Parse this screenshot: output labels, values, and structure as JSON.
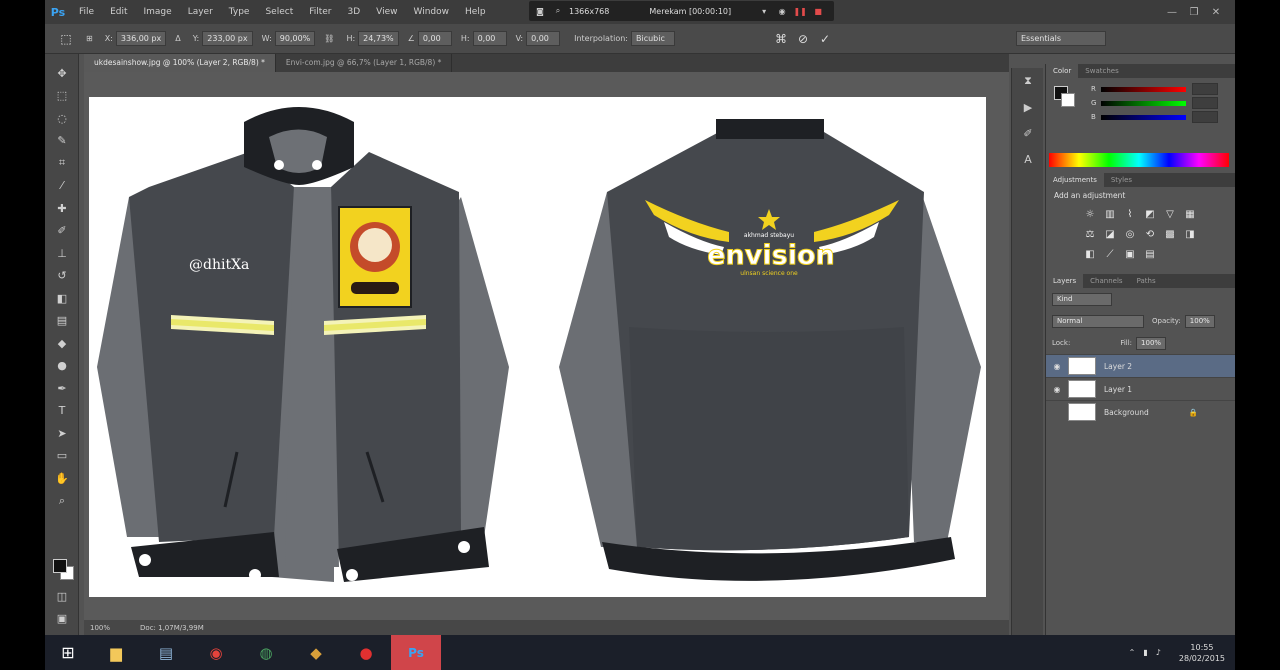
{
  "menubar": {
    "logo": "Ps",
    "items": [
      "File",
      "Edit",
      "Image",
      "Layer",
      "Type",
      "Select",
      "Filter",
      "3D",
      "View",
      "Window",
      "Help"
    ]
  },
  "recorder": {
    "resolution": "1366x768",
    "status": "Merekam [00:00:10]"
  },
  "options_bar": {
    "x": "336,00 px",
    "y": "233,00 px",
    "w": "90,00%",
    "h": "24,73%",
    "angle": "0,00",
    "h_skew": "0,00",
    "v_skew": "0,00",
    "interpolation_label": "Interpolation:",
    "interpolation": "Bicubic",
    "workspace": "Essentials"
  },
  "tabs": [
    "ukdesainshow.jpg @ 100% (Layer 2, RGB/8) *",
    "Envi-com.jpg @ 66,7% (Layer 1, RGB/8) *"
  ],
  "canvas": {
    "handle_text": "@dhitXa",
    "logo_brand": "envision",
    "logo_sub": "akhmad stebayu",
    "logo_tag": "ulnsan science one"
  },
  "status_bar": {
    "zoom": "100%",
    "doc": "Doc: 1,07M/3,99M"
  },
  "panels": {
    "color_tabs": [
      "Color",
      "Swatches"
    ],
    "color_channels": [
      "R",
      "G",
      "B"
    ],
    "adjust_tabs": [
      "Adjustments",
      "Styles"
    ],
    "adjust_title": "Add an adjustment",
    "layers_tabs": [
      "Layers",
      "Channels",
      "Paths"
    ],
    "kind": "Kind",
    "blend_mode": "Normal",
    "opacity_label": "Opacity:",
    "opacity": "100%",
    "lock_label": "Lock:",
    "fill_label": "Fill:",
    "fill": "100%",
    "layers": [
      "Layer 2",
      "Layer 1",
      "Background"
    ]
  },
  "taskbar": {
    "time": "10:55",
    "date": "28/02/2015"
  },
  "colors": {
    "jacket_body": "#45484d",
    "jacket_sleeve": "#6b6e73",
    "jacket_collar": "#1e2024",
    "stripe": "#e9e86a",
    "accent_yellow": "#f2d21f",
    "ps_blue": "#3ba3f2"
  }
}
